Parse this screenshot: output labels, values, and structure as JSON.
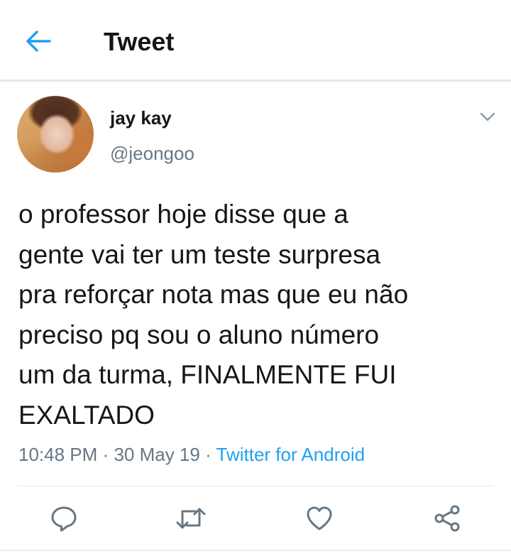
{
  "header": {
    "title": "Tweet",
    "back_icon": "arrow-left-icon",
    "accent_color": "#1da1f2"
  },
  "tweet": {
    "author": {
      "display_name": "jay kay",
      "handle": "@jeongoo"
    },
    "text_lines": [
      "o professor hoje disse que a",
      "gente vai ter um teste surpresa",
      "pra reforçar nota mas que eu não",
      "preciso pq sou o aluno número",
      "um da turma, FINALMENTE FUI",
      "EXALTADO"
    ],
    "time": "10:48 PM",
    "date": "30 May 19",
    "separator": "·",
    "source": "Twitter for Android"
  },
  "actions": {
    "reply_icon": "reply-icon",
    "retweet_icon": "retweet-icon",
    "like_icon": "heart-icon",
    "share_icon": "share-icon",
    "icon_color": "#657786"
  },
  "colors": {
    "text_primary": "#14171a",
    "text_secondary": "#657786",
    "link": "#1da1f2"
  }
}
